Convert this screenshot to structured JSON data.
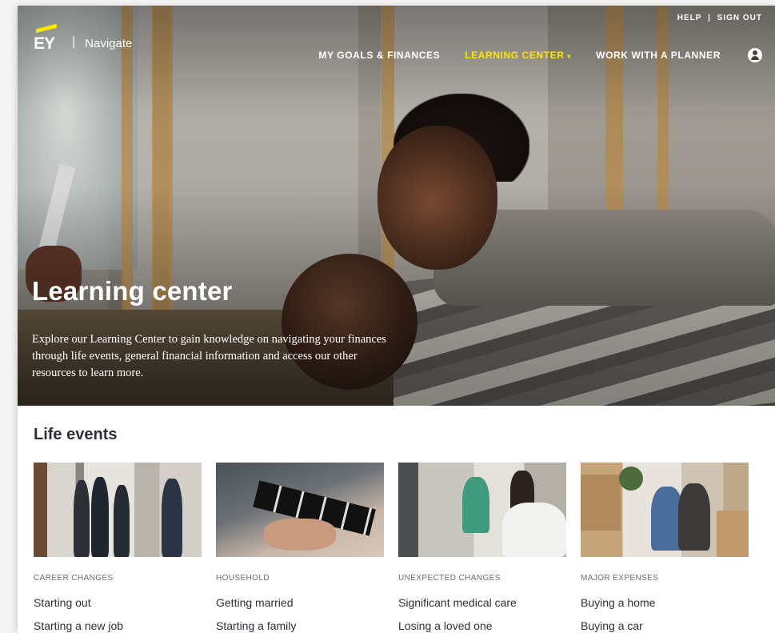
{
  "brand": {
    "logo": "EY",
    "separator": "|",
    "product": "Navigate",
    "accent": "#ffe600"
  },
  "utility_nav": {
    "help": "HELP",
    "separator": "|",
    "sign_out": "SIGN OUT"
  },
  "main_nav": {
    "goals": "MY GOALS & FINANCES",
    "learning": "LEARNING CENTER",
    "learning_caret": "▾",
    "planner": "WORK WITH A PLANNER",
    "user_icon": "user-circle-icon"
  },
  "hero": {
    "title": "Learning center",
    "description": "Explore our Learning Center to gain knowledge on navigating your finances through life events, general financial information and access our other resources to learn more."
  },
  "life_events": {
    "title": "Life events",
    "cards": [
      {
        "category": "CAREER CHANGES",
        "links": [
          "Starting out",
          "Starting a new job"
        ]
      },
      {
        "category": "HOUSEHOLD",
        "links": [
          "Getting married",
          "Starting a family"
        ]
      },
      {
        "category": "UNEXPECTED CHANGES",
        "links": [
          "Significant medical care",
          "Losing a loved one"
        ]
      },
      {
        "category": "MAJOR EXPENSES",
        "links": [
          "Buying a home",
          "Buying a car"
        ]
      }
    ]
  },
  "colors": {
    "text_dark": "#2e2e38",
    "nav_active": "#ffe600",
    "category_text": "#6b6b6b"
  }
}
